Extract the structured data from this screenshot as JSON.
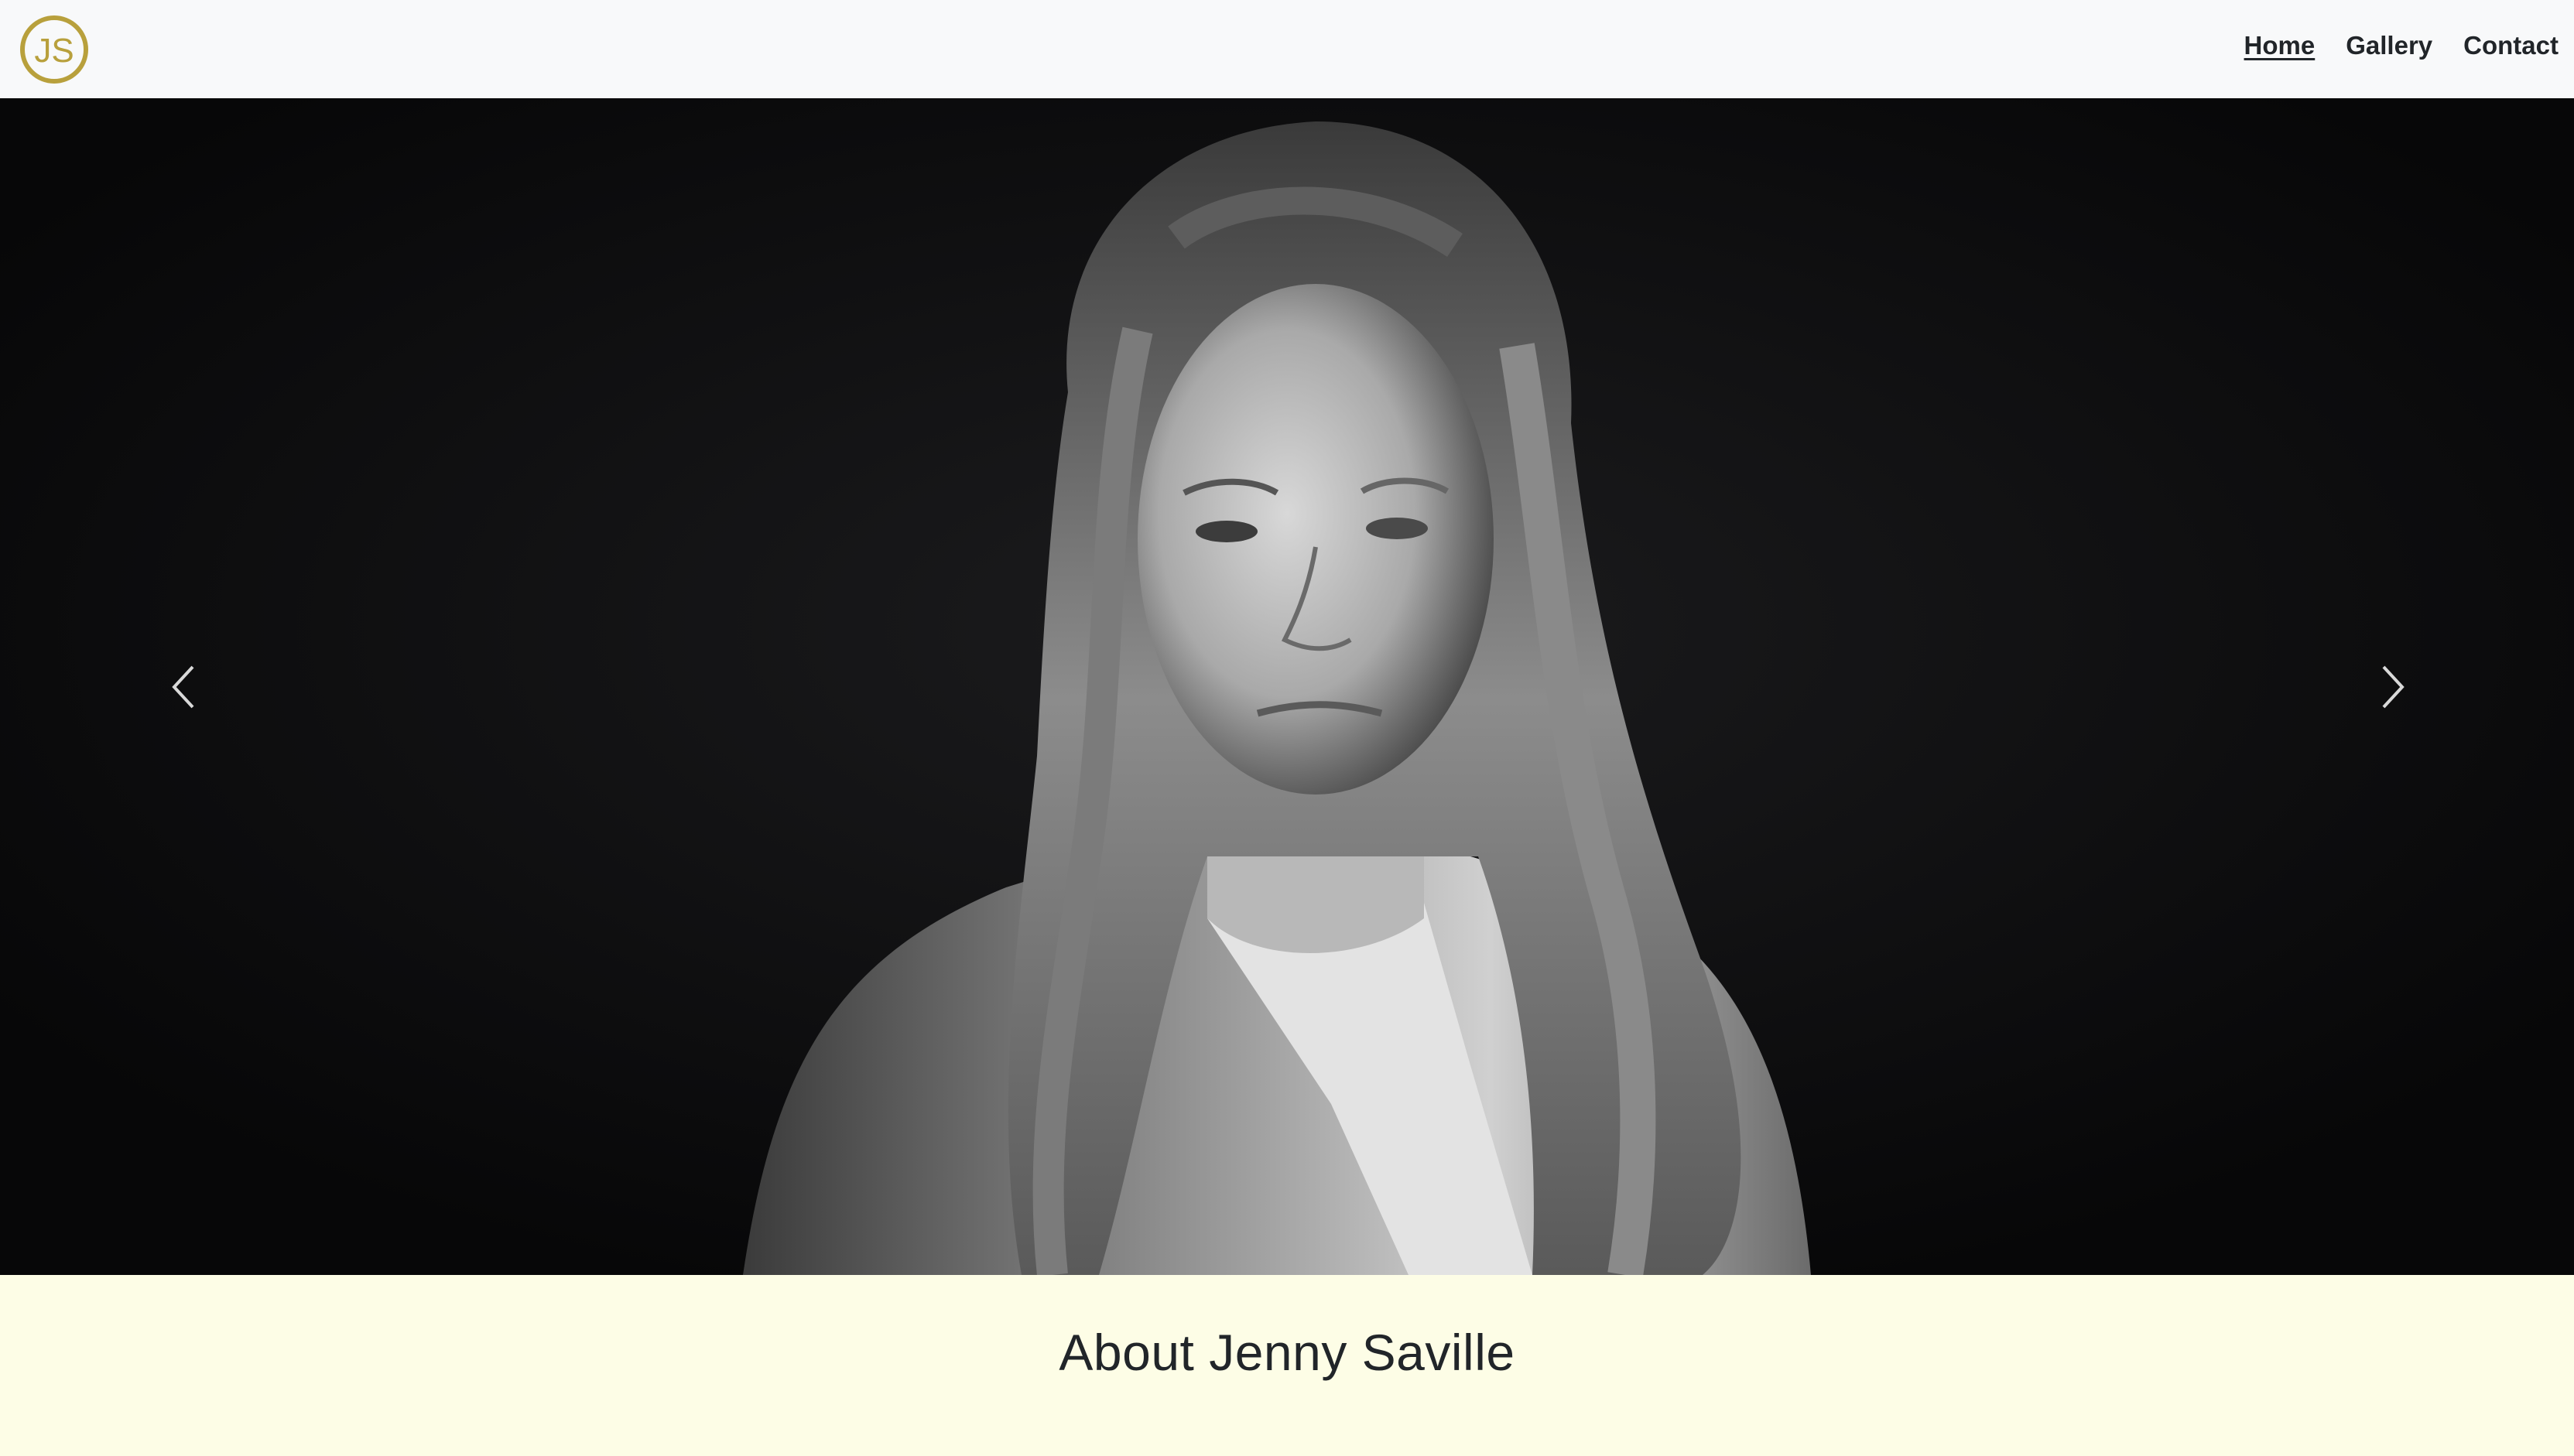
{
  "brand": {
    "logo_text": "JS",
    "logo_color": "#b8a03c"
  },
  "nav": {
    "items": [
      {
        "label": "Home",
        "active": true
      },
      {
        "label": "Gallery",
        "active": false
      },
      {
        "label": "Contact",
        "active": false
      }
    ]
  },
  "hero": {
    "prev_icon": "chevron-left-icon",
    "next_icon": "chevron-right-icon",
    "image_subject": "black-and-white portrait photo"
  },
  "about": {
    "title": "About Jenny Saville"
  },
  "colors": {
    "navbar_bg": "#f8f9fa",
    "text": "#212529",
    "about_bg": "#fdfde6",
    "hero_bg": "#0a0a0b"
  }
}
